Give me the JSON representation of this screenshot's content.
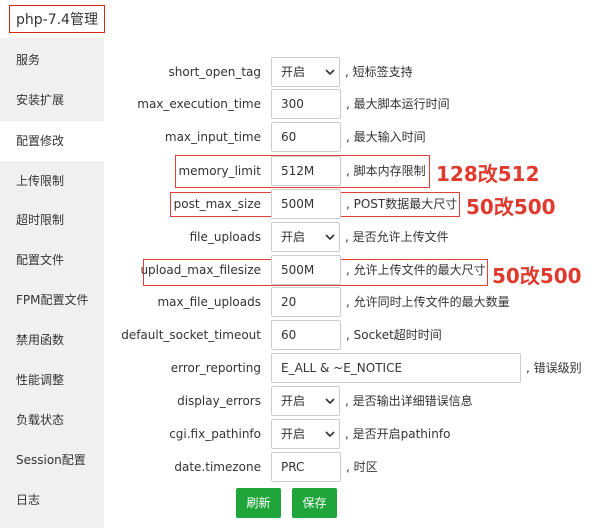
{
  "window": {
    "title": "php-7.4管理"
  },
  "sidebar": {
    "items": [
      {
        "label": "服务"
      },
      {
        "label": "安装扩展"
      },
      {
        "label": "配置修改"
      },
      {
        "label": "上传限制"
      },
      {
        "label": "超时限制"
      },
      {
        "label": "配置文件"
      },
      {
        "label": "FPM配置文件"
      },
      {
        "label": "禁用函数"
      },
      {
        "label": "性能调整"
      },
      {
        "label": "负载状态"
      },
      {
        "label": "Session配置"
      },
      {
        "label": "日志"
      }
    ],
    "active": "配置修改"
  },
  "settings": [
    {
      "key": "short_open_tag",
      "type": "select",
      "value": "开启",
      "desc": ", 短标签支持"
    },
    {
      "key": "max_execution_time",
      "type": "input",
      "value": "300",
      "desc": ", 最大脚本运行时间"
    },
    {
      "key": "max_input_time",
      "type": "input",
      "value": "60",
      "desc": ", 最大输入时间"
    },
    {
      "key": "memory_limit",
      "type": "input",
      "value": "512M",
      "desc": ", 脚本内存限制"
    },
    {
      "key": "post_max_size",
      "type": "input",
      "value": "500M",
      "desc": ", POST数据最大尺寸"
    },
    {
      "key": "file_uploads",
      "type": "select",
      "value": "开启",
      "desc": ", 是否允许上传文件"
    },
    {
      "key": "upload_max_filesize",
      "type": "input",
      "value": "500M",
      "desc": ", 允许上传文件的最大尺寸"
    },
    {
      "key": "max_file_uploads",
      "type": "input",
      "value": "20",
      "desc": ", 允许同时上传文件的最大数量"
    },
    {
      "key": "default_socket_timeout",
      "type": "input",
      "value": "60",
      "desc": ", Socket超时时间"
    },
    {
      "key": "error_reporting",
      "type": "wide",
      "value": "E_ALL & ~E_NOTICE",
      "desc": ", 错误级别"
    },
    {
      "key": "display_errors",
      "type": "select",
      "value": "开启",
      "desc": ", 是否输出详细错误信息"
    },
    {
      "key": "cgi.fix_pathinfo",
      "type": "select",
      "value": "开启",
      "desc": ", 是否开启pathinfo"
    },
    {
      "key": "date.timezone",
      "type": "input",
      "value": "PRC",
      "desc": ", 时区"
    }
  ],
  "annotations": {
    "memory_limit": "128改512",
    "post_max_size": "50改500",
    "upload_max_filesize": "50改500"
  },
  "buttons": {
    "refresh": "刷新",
    "save": "保存"
  },
  "colors": {
    "accent": "#20a53a",
    "annotation": "#e03a2e"
  }
}
